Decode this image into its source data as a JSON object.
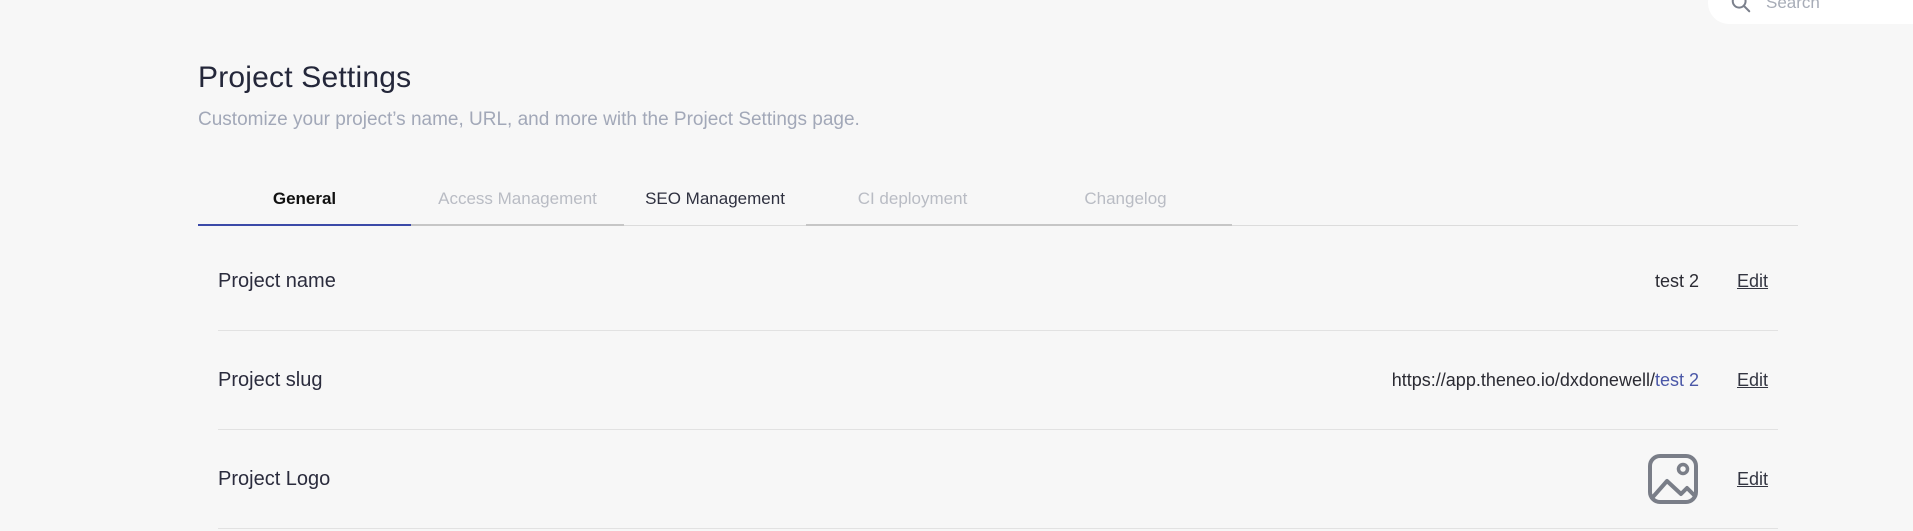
{
  "search": {
    "placeholder": "Search"
  },
  "header": {
    "title": "Project Settings",
    "subtitle": "Customize your project’s name, URL, and more with the Project Settings page."
  },
  "tabs": [
    {
      "label": "General",
      "state": "active"
    },
    {
      "label": "Access Management",
      "state": "disabled"
    },
    {
      "label": "SEO Management",
      "state": "enabled"
    },
    {
      "label": "CI deployment",
      "state": "disabled"
    },
    {
      "label": "Changelog",
      "state": "disabled"
    }
  ],
  "settings": {
    "project_name": {
      "label": "Project name",
      "value": "test 2",
      "edit_label": "Edit"
    },
    "project_slug": {
      "label": "Project slug",
      "url_prefix": "https://app.theneo.io/dxdonewell/",
      "slug": "test 2",
      "edit_label": "Edit"
    },
    "project_logo": {
      "label": "Project Logo",
      "logo_icon": "image-placeholder-icon",
      "edit_label": "Edit"
    }
  },
  "colors": {
    "accent": "#3b4aa8",
    "slug_accent": "#4a57a7",
    "background": "#f7f7f7"
  }
}
